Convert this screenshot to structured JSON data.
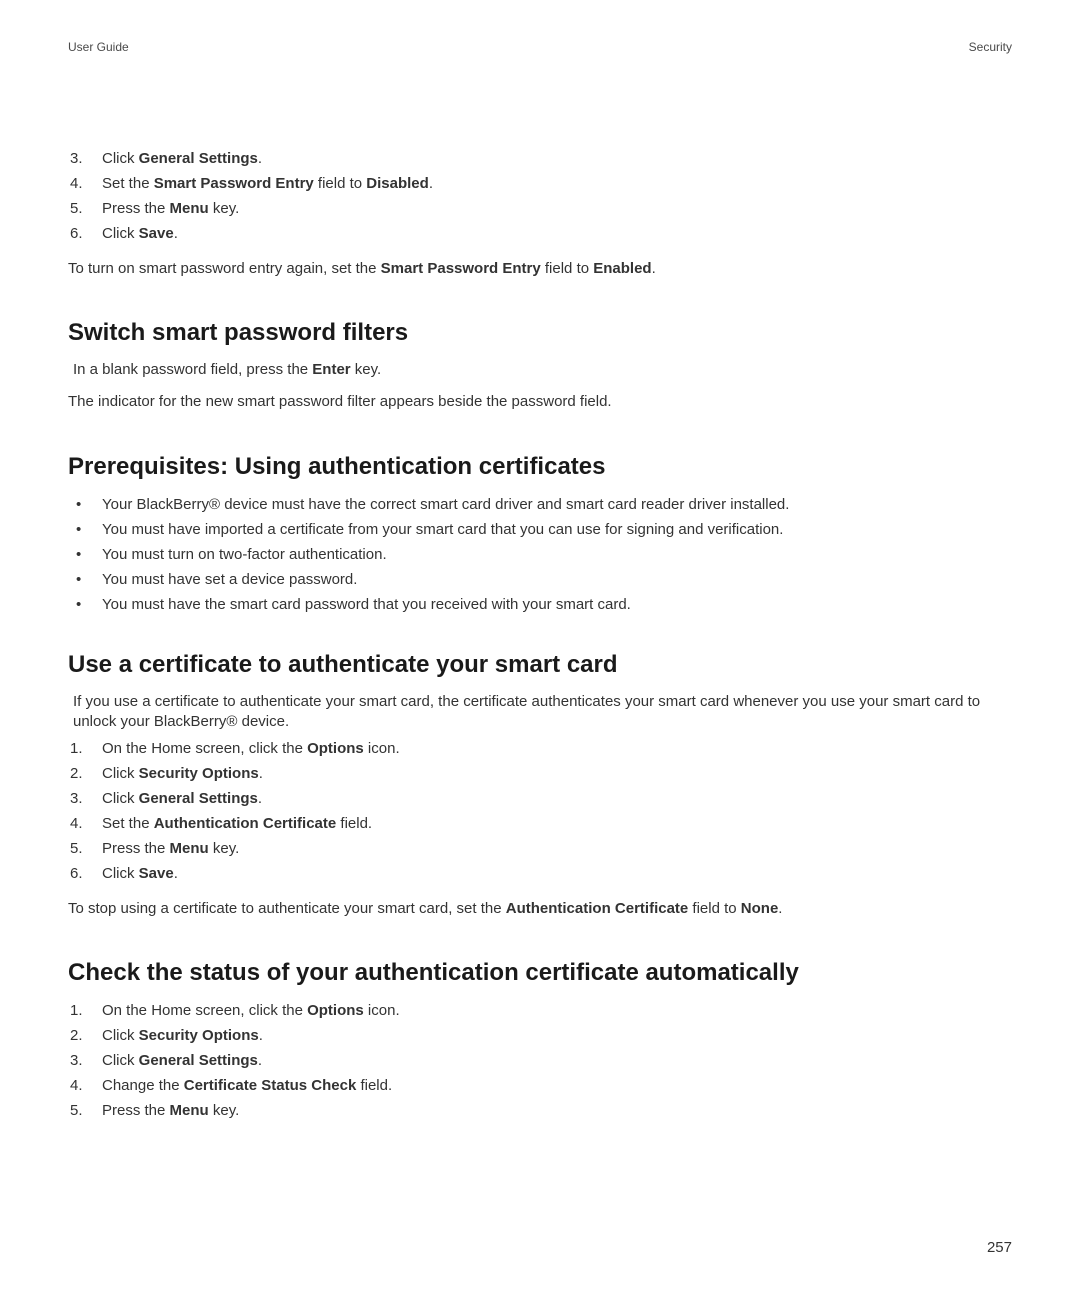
{
  "header": {
    "left": "User Guide",
    "right": "Security"
  },
  "intro_steps": [
    {
      "num": "3.",
      "pre": "Click ",
      "bold": "General Settings",
      "post": "."
    },
    {
      "num": "4.",
      "pre": "Set the ",
      "bold": "Smart Password Entry",
      "mid": " field to ",
      "bold2": "Disabled",
      "post": "."
    },
    {
      "num": "5.",
      "pre": "Press the ",
      "bold": "Menu",
      "post": " key."
    },
    {
      "num": "6.",
      "pre": "Click ",
      "bold": "Save",
      "post": "."
    }
  ],
  "intro_note": {
    "pre": "To turn on smart password entry again, set the ",
    "bold1": "Smart Password Entry",
    "mid": " field to ",
    "bold2": "Enabled",
    "post": "."
  },
  "section1": {
    "heading": "Switch smart password filters",
    "para1_pre": "In a blank password field, press the ",
    "para1_bold": "Enter",
    "para1_post": " key.",
    "para2": "The indicator for the new smart password filter appears beside the password field."
  },
  "section2": {
    "heading": "Prerequisites: Using authentication certificates",
    "bullets": [
      "Your BlackBerry® device must have the correct smart card driver and smart card reader driver installed.",
      "You must have imported a certificate from your smart card that you can use for signing and verification.",
      "You must turn on two-factor authentication.",
      "You must have set a device password.",
      "You must have the smart card password that you received with your smart card."
    ]
  },
  "section3": {
    "heading": "Use a certificate to authenticate your smart card",
    "intro": "If you use a certificate to authenticate your smart card, the certificate authenticates your smart card whenever you use your smart card to unlock your BlackBerry® device.",
    "steps": [
      {
        "num": "1.",
        "pre": "On the Home screen, click the ",
        "bold": "Options",
        "post": " icon."
      },
      {
        "num": "2.",
        "pre": "Click ",
        "bold": "Security Options",
        "post": "."
      },
      {
        "num": "3.",
        "pre": "Click ",
        "bold": "General Settings",
        "post": "."
      },
      {
        "num": "4.",
        "pre": "Set the ",
        "bold": "Authentication Certificate",
        "post": " field."
      },
      {
        "num": "5.",
        "pre": "Press the ",
        "bold": "Menu",
        "post": " key."
      },
      {
        "num": "6.",
        "pre": "Click ",
        "bold": "Save",
        "post": "."
      }
    ],
    "note_pre": "To stop using a certificate to authenticate your smart card, set the ",
    "note_bold1": "Authentication Certificate",
    "note_mid": " field to ",
    "note_bold2": "None",
    "note_post": "."
  },
  "section4": {
    "heading": "Check the status of your authentication certificate automatically",
    "steps": [
      {
        "num": "1.",
        "pre": "On the Home screen, click the ",
        "bold": "Options",
        "post": " icon."
      },
      {
        "num": "2.",
        "pre": "Click ",
        "bold": "Security Options",
        "post": "."
      },
      {
        "num": "3.",
        "pre": "Click ",
        "bold": "General Settings",
        "post": "."
      },
      {
        "num": "4.",
        "pre": "Change the ",
        "bold": "Certificate Status Check",
        "post": " field."
      },
      {
        "num": "5.",
        "pre": "Press the ",
        "bold": "Menu",
        "post": " key."
      }
    ]
  },
  "page_number": "257"
}
